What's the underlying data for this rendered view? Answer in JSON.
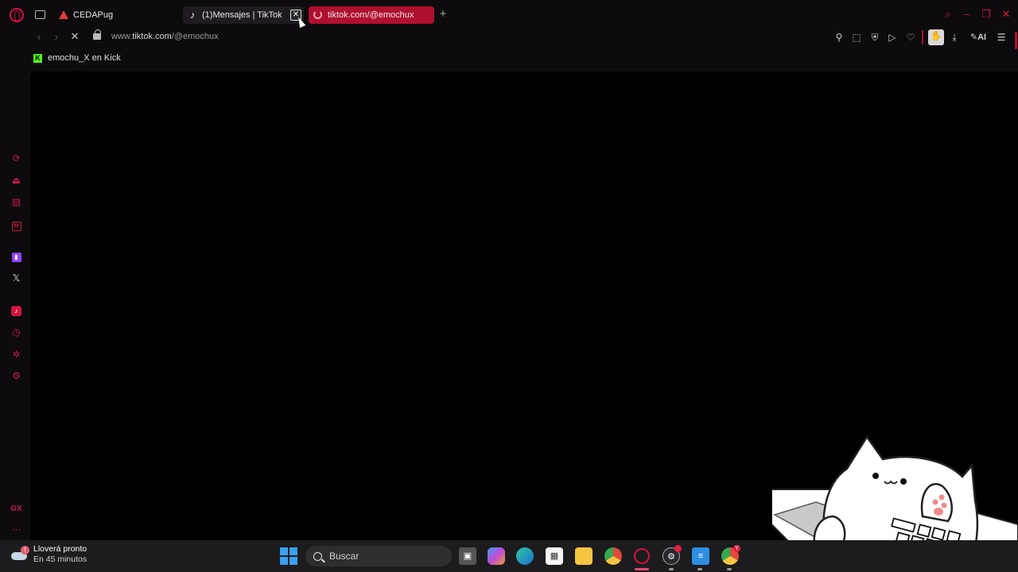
{
  "browser": {
    "tabs": [
      {
        "label": "CEDAPug",
        "favicon": "warning-triangle-icon"
      },
      {
        "label": "(1)Mensajes | TikTok",
        "favicon": "tiktok-icon",
        "close_glyph": "✕"
      },
      {
        "label": "tiktok.com/@emochux",
        "favicon": "loading-spinner-icon",
        "active": true
      }
    ],
    "newtab_glyph": "+",
    "address": {
      "prefix": "www.",
      "host": "tiktok.com",
      "path": "/@emochux"
    },
    "toolbar": {
      "ai_label": "AI"
    },
    "bookmarks": [
      {
        "label": "emochu_X en Kick",
        "icon": "kick-icon"
      }
    ],
    "sidebar": {
      "gx_label": "GX",
      "more_glyph": "···"
    },
    "colors": {
      "accent": "#d4123f",
      "active_tab": "#b0102f",
      "page_background": "#000000"
    }
  },
  "taskbar": {
    "weather": {
      "title": "Lloverá pronto",
      "subtitle": "En 45 minutos",
      "badge": "!"
    },
    "search_placeholder": "Buscar",
    "chrome2_badge": "Y"
  }
}
